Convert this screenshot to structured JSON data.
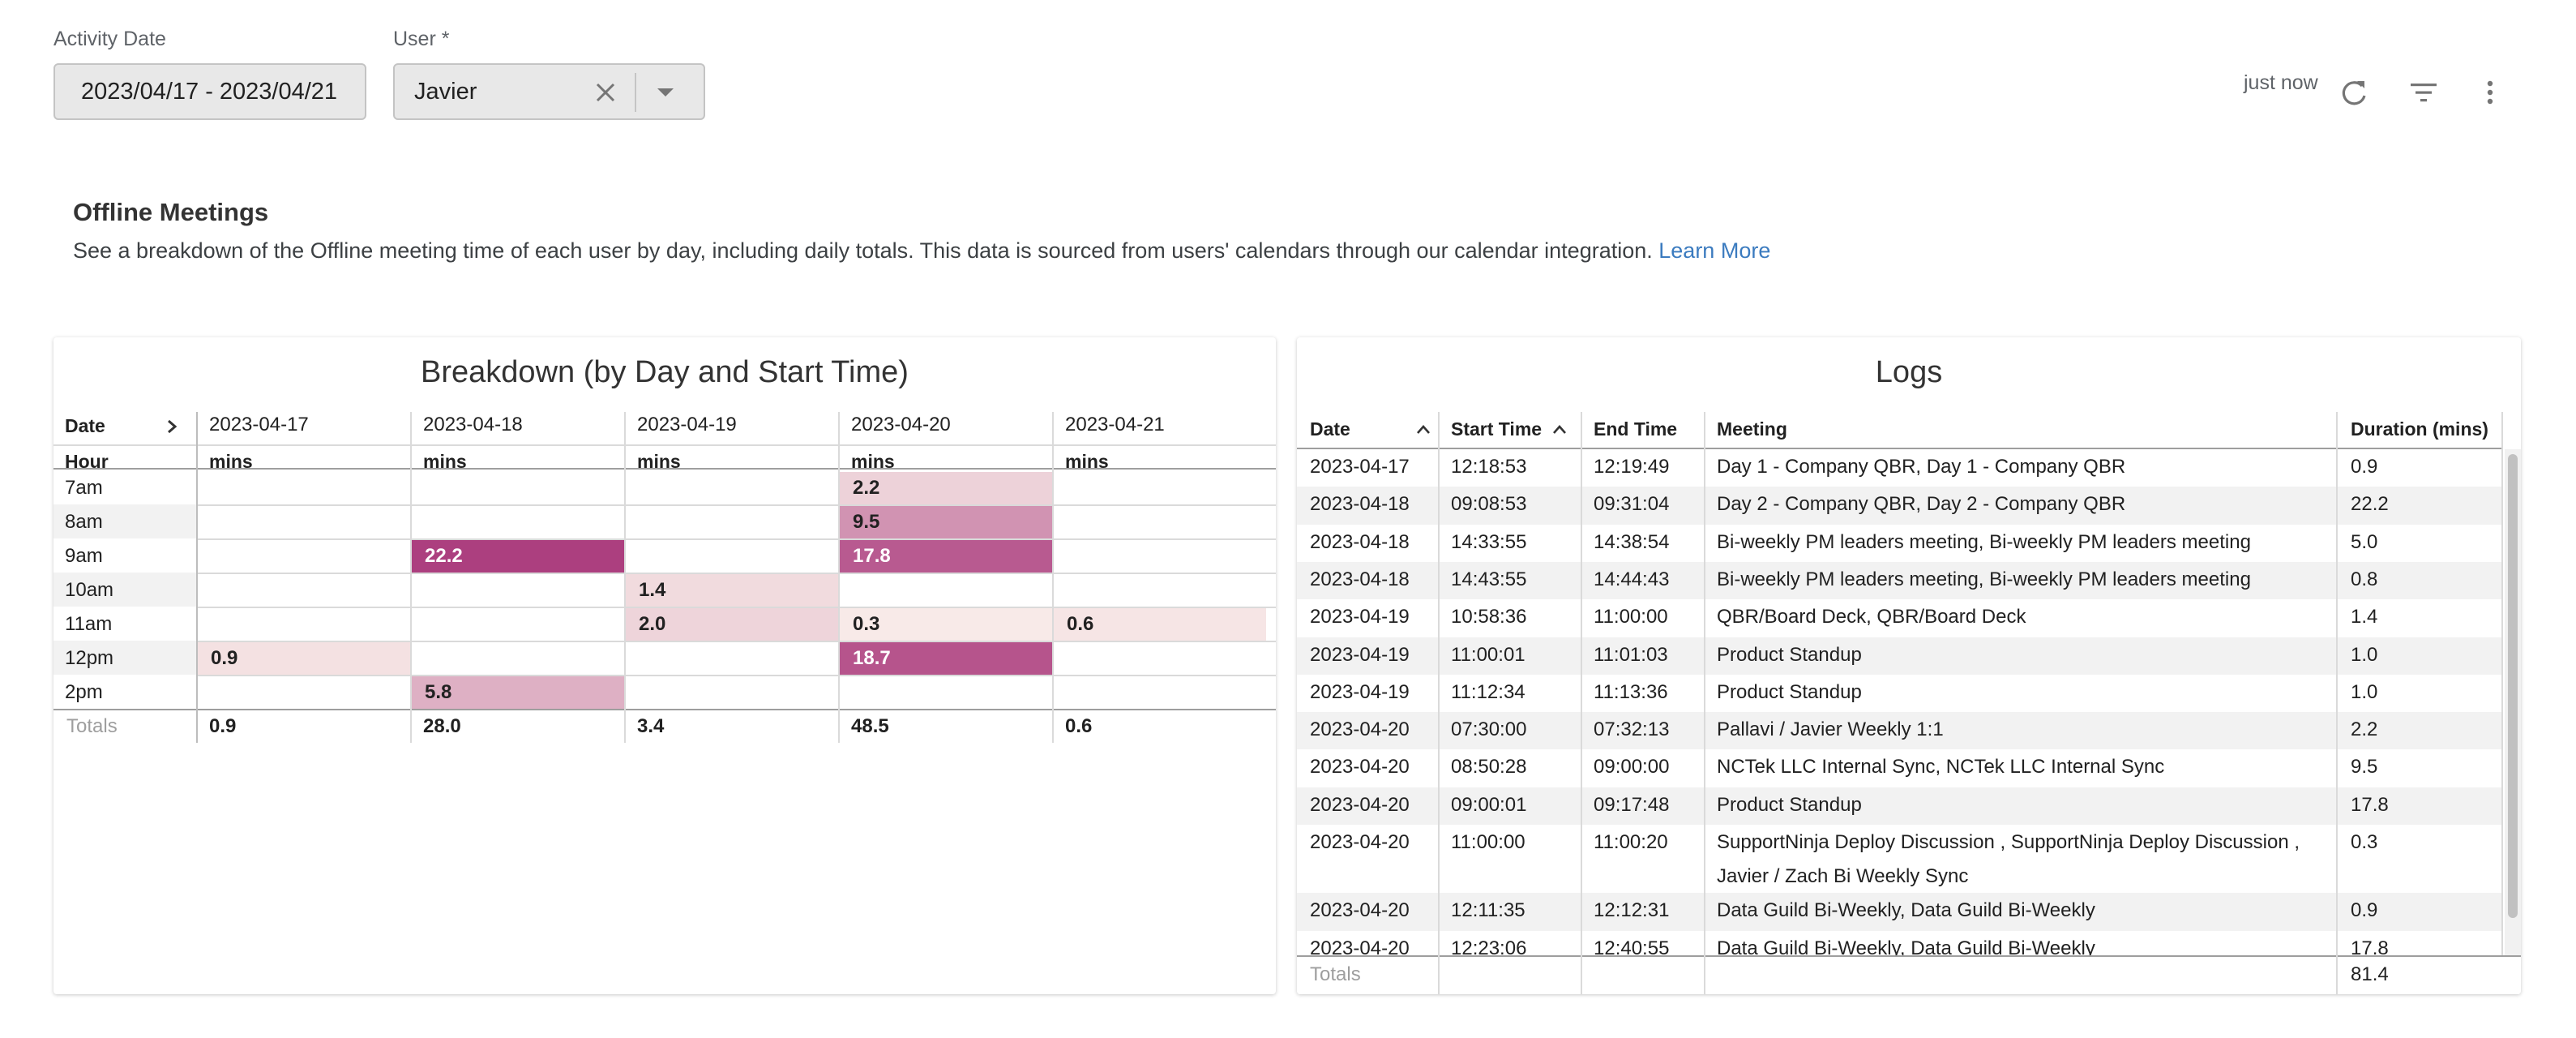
{
  "filters": {
    "activity_date_label": "Activity Date",
    "activity_date_value": "2023/04/17 - 2023/04/21",
    "user_label": "User",
    "user_required_mark": "*",
    "user_value": "Javier",
    "icons": [
      "close-icon",
      "caret-down-icon"
    ]
  },
  "toolbar": {
    "updated_text": "just now",
    "icons": [
      "refresh-icon",
      "filter-icon",
      "more-vert-icon"
    ]
  },
  "section": {
    "title": "Offline Meetings",
    "description": "See a breakdown of the Offline meeting time of each user by day, including daily totals. This data is sourced from users' calendars through our calendar integration.",
    "link_text": "Learn More",
    "link_color": "#3b7bbf"
  },
  "breakdown": {
    "title": "Breakdown (by Day and Start Time)",
    "row_header_top": "Date",
    "row_header_bottom": "Hour",
    "expand_icon": "chevron-right-icon",
    "dates": [
      "2023-04-17",
      "2023-04-18",
      "2023-04-19",
      "2023-04-20",
      "2023-04-21"
    ],
    "unit": "mins",
    "hours": [
      "7am",
      "8am",
      "9am",
      "10am",
      "11am",
      "12pm",
      "2pm"
    ],
    "cells": [
      [
        "",
        "",
        "",
        "2.2",
        ""
      ],
      [
        "",
        "",
        "",
        "9.5",
        ""
      ],
      [
        "",
        "22.2",
        "",
        "17.8",
        ""
      ],
      [
        "",
        "",
        "1.4",
        "",
        ""
      ],
      [
        "",
        "",
        "2.0",
        "0.3",
        "0.6"
      ],
      [
        "0.9",
        "",
        "",
        "18.7",
        ""
      ],
      [
        "",
        "5.8",
        "",
        "",
        ""
      ]
    ],
    "totals_label": "Totals",
    "totals": [
      "0.9",
      "28.0",
      "3.4",
      "48.5",
      "0.6"
    ],
    "heat_colors": {
      "low": "#fbf1ec",
      "high": "#ac3f7f"
    }
  },
  "logs": {
    "title": "Logs",
    "columns": [
      "Date",
      "Start Time",
      "End Time",
      "Meeting",
      "Duration (mins)"
    ],
    "sort_icons": [
      "sort-asc-icon",
      "sort-asc-icon"
    ],
    "rows": [
      [
        "2023-04-17",
        "12:18:53",
        "12:19:49",
        "Day 1 - Company QBR, Day 1 - Company QBR",
        "0.9"
      ],
      [
        "2023-04-18",
        "09:08:53",
        "09:31:04",
        "Day 2 - Company QBR, Day 2 - Company QBR",
        "22.2"
      ],
      [
        "2023-04-18",
        "14:33:55",
        "14:38:54",
        "Bi-weekly PM leaders meeting, Bi-weekly PM leaders meeting",
        "5.0"
      ],
      [
        "2023-04-18",
        "14:43:55",
        "14:44:43",
        "Bi-weekly PM leaders meeting, Bi-weekly PM leaders meeting",
        "0.8"
      ],
      [
        "2023-04-19",
        "10:58:36",
        "11:00:00",
        "QBR/Board Deck, QBR/Board Deck",
        "1.4"
      ],
      [
        "2023-04-19",
        "11:00:01",
        "11:01:03",
        "Product Standup",
        "1.0"
      ],
      [
        "2023-04-19",
        "11:12:34",
        "11:13:36",
        "Product Standup",
        "1.0"
      ],
      [
        "2023-04-20",
        "07:30:00",
        "07:32:13",
        "Pallavi / Javier Weekly 1:1",
        "2.2"
      ],
      [
        "2023-04-20",
        "08:50:28",
        "09:00:00",
        "NCTek LLC Internal Sync, NCTek LLC Internal Sync",
        "9.5"
      ],
      [
        "2023-04-20",
        "09:00:01",
        "09:17:48",
        "Product Standup",
        "17.8"
      ],
      [
        "2023-04-20",
        "11:00:00",
        "11:00:20",
        "SupportNinja Deploy Discussion , SupportNinja Deploy Discussion , ",
        "0.3"
      ],
      [
        "",
        "",
        "",
        "Javier / Zach Bi Weekly Sync",
        ""
      ],
      [
        "2023-04-20",
        "12:11:35",
        "12:12:31",
        "Data Guild Bi-Weekly, Data Guild Bi-Weekly",
        "0.9"
      ],
      [
        "2023-04-20",
        "12:23:06",
        "12:40:55",
        "Data Guild Bi-Weekly, Data Guild Bi-Weekly",
        "17.8"
      ]
    ],
    "totals_label": "Totals",
    "total_duration": "81.4"
  }
}
